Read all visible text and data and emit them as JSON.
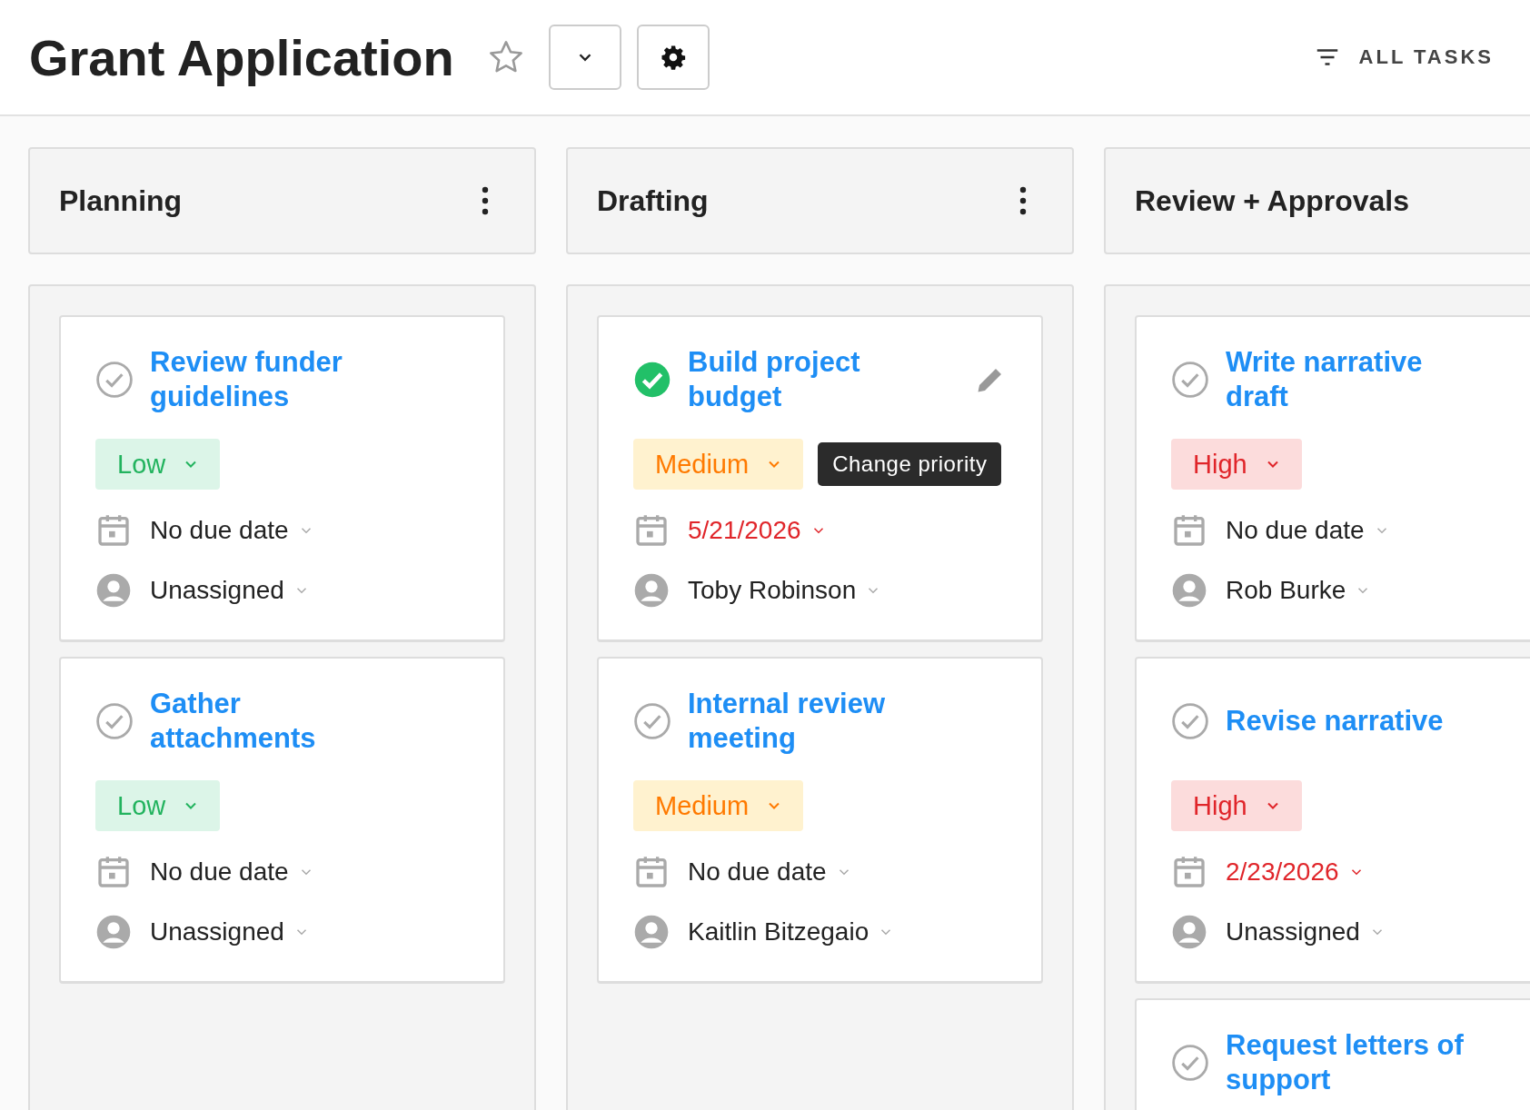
{
  "header": {
    "title": "Grant Application",
    "filter_label": "ALL TASKS"
  },
  "columns": [
    {
      "title": "Planning",
      "menu": true,
      "tasks": [
        {
          "title": "Review funder guidelines",
          "done": false,
          "priority": {
            "label": "Low",
            "kind": "low"
          },
          "due": {
            "text": "No due date",
            "overdue": false
          },
          "assignee": "Unassigned"
        },
        {
          "title": "Gather attachments",
          "done": false,
          "priority": {
            "label": "Low",
            "kind": "low"
          },
          "due": {
            "text": "No due date",
            "overdue": false
          },
          "assignee": "Unassigned"
        }
      ]
    },
    {
      "title": "Drafting",
      "menu": true,
      "tasks": [
        {
          "title": "Build project budget",
          "done": true,
          "editing": true,
          "tooltip": "Change priority",
          "priority": {
            "label": "Medium",
            "kind": "medium"
          },
          "due": {
            "text": "5/21/2026",
            "overdue": true
          },
          "assignee": "Toby Robinson"
        },
        {
          "title": "Internal review meeting",
          "done": false,
          "priority": {
            "label": "Medium",
            "kind": "medium"
          },
          "due": {
            "text": "No due date",
            "overdue": false
          },
          "assignee": "Kaitlin Bitzegaio"
        }
      ]
    },
    {
      "title": "Review + Approvals",
      "menu": false,
      "tasks": [
        {
          "title": "Write narrative draft",
          "done": false,
          "priority": {
            "label": "High",
            "kind": "high"
          },
          "due": {
            "text": "No due date",
            "overdue": false
          },
          "assignee": "Rob Burke"
        },
        {
          "title": "Revise narrative",
          "done": false,
          "priority": {
            "label": "High",
            "kind": "high"
          },
          "due": {
            "text": "2/23/2026",
            "overdue": true
          },
          "assignee": "Unassigned"
        },
        {
          "title": "Request letters of support",
          "done": false
        }
      ]
    }
  ]
}
